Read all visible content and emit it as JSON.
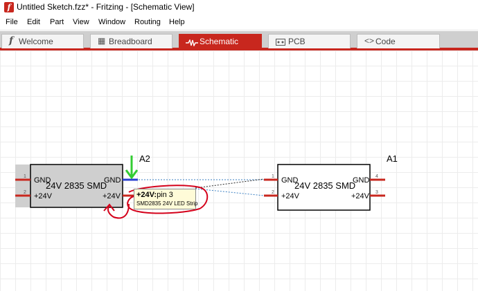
{
  "window": {
    "title": "Untitled Sketch.fzz* - Fritzing - [Schematic View]",
    "app_icon_glyph": "f"
  },
  "menu": {
    "items": [
      "File",
      "Edit",
      "Part",
      "View",
      "Window",
      "Routing",
      "Help"
    ]
  },
  "tabs": [
    {
      "label": "Welcome",
      "icon": "fritzing-f-icon",
      "glyph": "f",
      "active": false
    },
    {
      "label": "Breadboard",
      "icon": "breadboard-icon",
      "glyph": "▦",
      "active": false
    },
    {
      "label": "Schematic",
      "icon": "schematic-wave-icon",
      "glyph": "~",
      "active": true
    },
    {
      "label": "PCB",
      "icon": "pcb-icon",
      "glyph": "▭",
      "active": false
    },
    {
      "label": "Code",
      "icon": "code-brackets-icon",
      "glyph": "<>",
      "active": false
    }
  ],
  "colors": {
    "accent": "#c8271e",
    "pin": "#c8271e",
    "selected_pin": "#2a3fd0",
    "annotation_arrow": "#33cc33",
    "annotation_circle": "#d4001a",
    "ratsnest_black": "#222222",
    "ratsnest_blue": "#3a7fc2",
    "part_selected_fill": "#cfcfcf",
    "tooltip_bg": "#fffbd8"
  },
  "schematic": {
    "part_a2": {
      "label": "A2",
      "title": "24V 2835 SMD",
      "pin1_number": "1",
      "pin2_number": "2",
      "left_pin1_label": "GND",
      "left_pin2_label": "+24V",
      "right_pin1_label": "GND",
      "right_pin2_label": "+24V",
      "selected": true
    },
    "part_a1": {
      "label": "A1",
      "title": "24V 2835 SMD",
      "pin1_number": "1",
      "pin2_number": "2",
      "pin3_number": "3",
      "pin4_number": "4",
      "left_pin1_label": "GND",
      "left_pin2_label": "+24V",
      "right_pin1_label": "GND",
      "right_pin2_label": "+24V"
    },
    "tooltip": {
      "pin_name": "+24V:",
      "pin_id": "pin 3",
      "part_name": "SMD2835 24V LED Strip"
    }
  }
}
